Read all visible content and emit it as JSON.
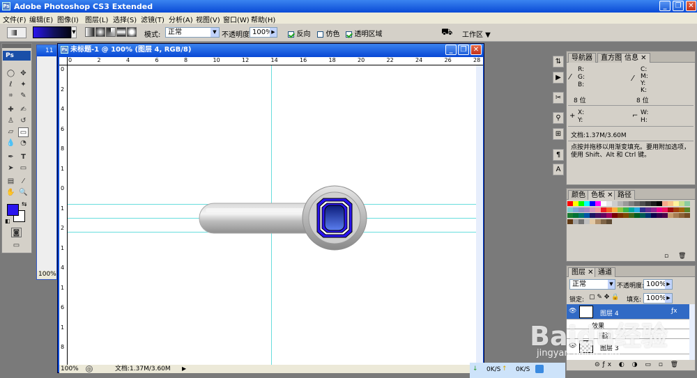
{
  "app": {
    "title": "Adobe Photoshop CS3 Extended",
    "icon_text": "Ps"
  },
  "menus": [
    "文件(F)",
    "编辑(E)",
    "图像(I)",
    "图层(L)",
    "选择(S)",
    "滤镜(T)",
    "分析(A)",
    "视图(V)",
    "窗口(W)",
    "帮助(H)"
  ],
  "options": {
    "mode_label": "模式:",
    "mode_value": "正常",
    "opacity_label": "不透明度:",
    "opacity_value": "100%",
    "reverse_label": "反向",
    "reverse_checked": true,
    "dither_label": "仿色",
    "dither_checked": false,
    "transparency_label": "透明区域",
    "transparency_checked": true,
    "workspace_label": "工作区"
  },
  "toolbox": {
    "logo": "Ps"
  },
  "doc2": {
    "title_fragment": "11",
    "zoom": "100%"
  },
  "doc": {
    "title": "未标题-1 @ 100% (图层 4, RGB/8)",
    "zoom": "100%",
    "status": "文档:1.37M/3.60M",
    "ruler_h": [
      "0",
      "2",
      "4",
      "6",
      "8",
      "10",
      "12",
      "14",
      "16",
      "18",
      "20",
      "22",
      "24",
      "26",
      "28"
    ],
    "ruler_v": [
      "0",
      "2",
      "4",
      "6",
      "8",
      "1",
      "0",
      "1",
      "2",
      "1",
      "4",
      "1",
      "6",
      "1",
      "8"
    ]
  },
  "info_panel": {
    "tabs": [
      "导航器",
      "直方图",
      "信息"
    ],
    "r": "R:",
    "g": "G:",
    "b": "B:",
    "c": "C:",
    "m": "M:",
    "y": "Y:",
    "k": "K:",
    "bits_left": "8 位",
    "bits_right": "8 位",
    "x": "X:",
    "yy": "Y:",
    "w": "W:",
    "h": "H:",
    "doc": "文档:1.37M/3.60M",
    "hint": "点按并拖移以用渐变填充。要用附加选项，使用 Shift、Alt 和 Ctrl 键。"
  },
  "swatch_panel": {
    "tabs": [
      "颜色",
      "色板",
      "路径"
    ]
  },
  "layers_panel": {
    "tabs": [
      "图层",
      "通道"
    ],
    "blend": "正常",
    "opacity_label": "不透明度:",
    "opacity_value": "100%",
    "lock_label": "锁定:",
    "fill_label": "填充:",
    "fill_value": "100%",
    "layers": [
      {
        "name": "图层 4",
        "selected": true
      },
      {
        "name": "效果",
        "selected": false
      },
      {
        "name": "描边",
        "selected": false
      },
      {
        "name": "图层 3",
        "selected": false
      }
    ]
  },
  "taskbar": {
    "down_speed": "0K/S",
    "up_speed": "0K/S"
  },
  "watermark": {
    "brand": "Baidu经验",
    "url": "jingyan.baidu.com"
  },
  "colors": {
    "foreground": "#2a15ee",
    "background": "#ffffff",
    "accent": "#0a4ad6"
  }
}
